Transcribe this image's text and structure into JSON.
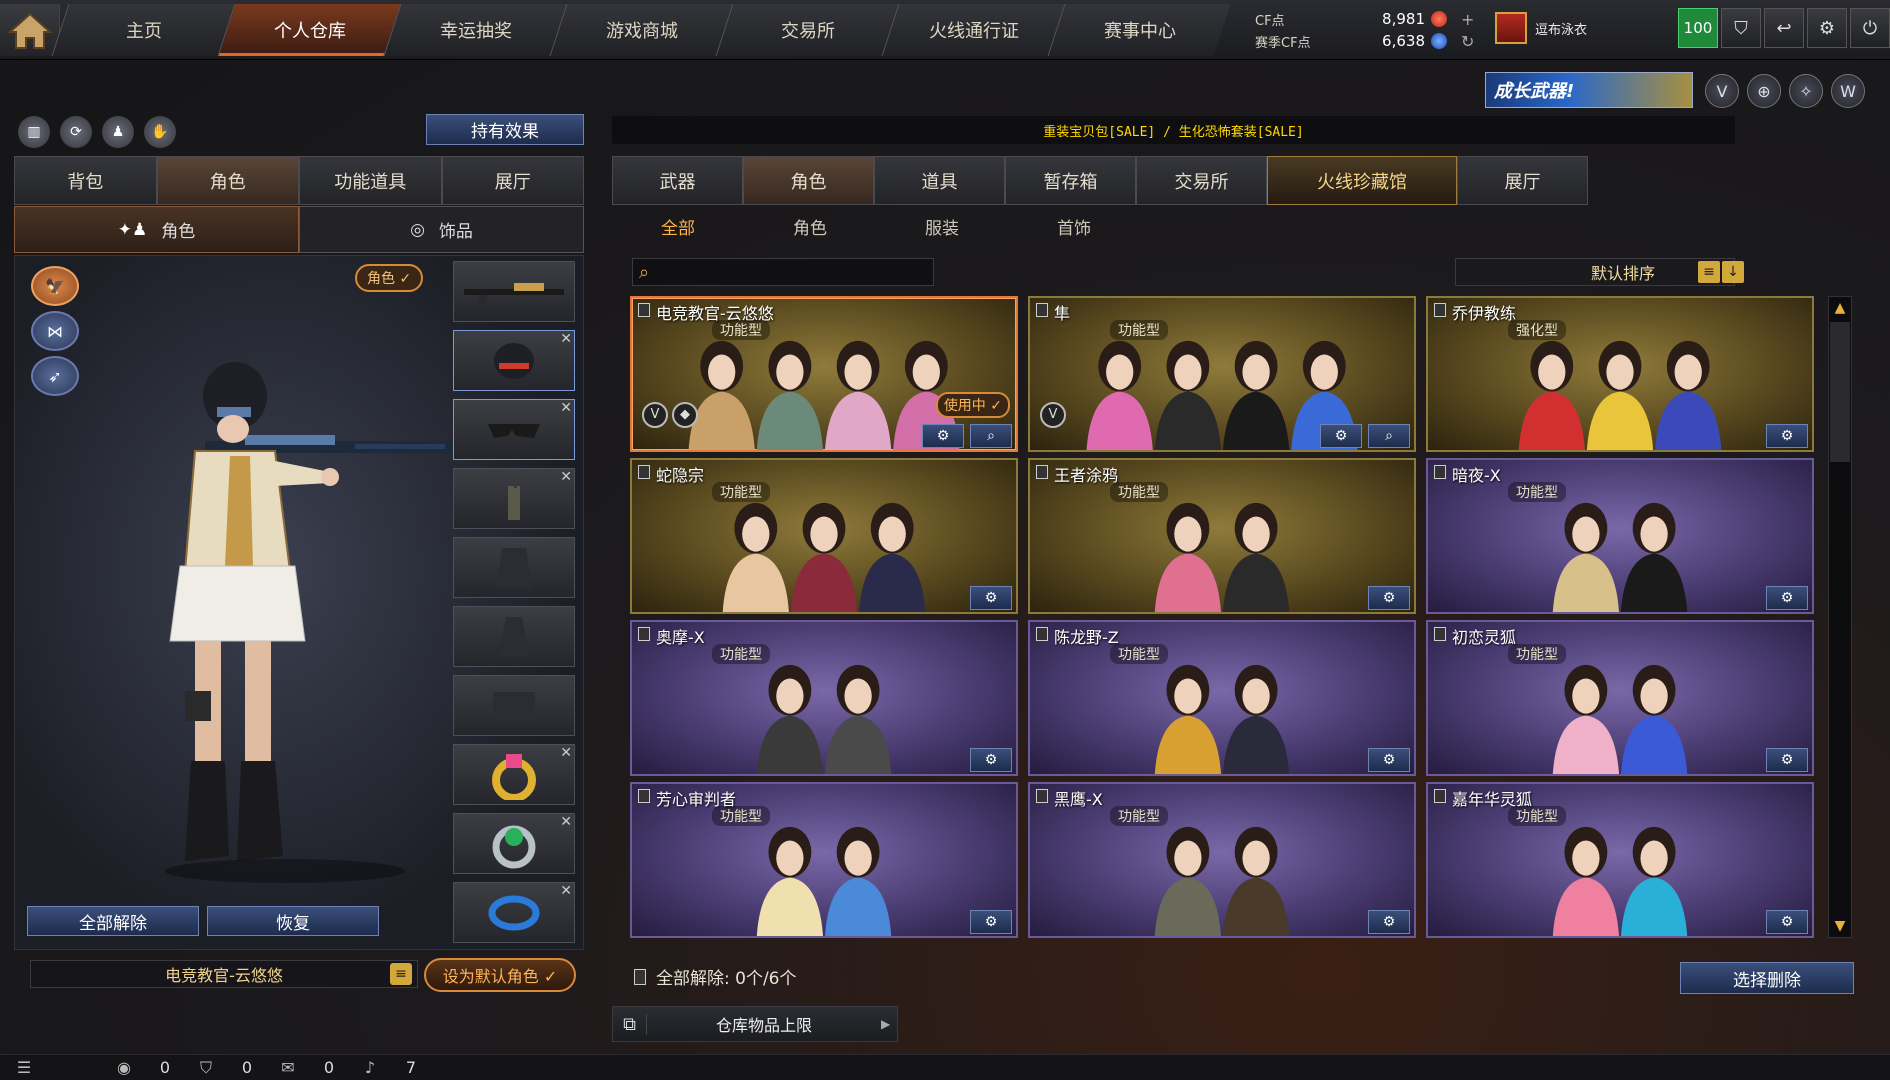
{
  "nav": {
    "home_icon": "home-icon",
    "tabs": [
      "主页",
      "个人仓库",
      "幸运抽奖",
      "游戏商城",
      "交易所",
      "火线通行证",
      "赛事中心"
    ],
    "active_tab": "个人仓库"
  },
  "currency": {
    "cf_label": "CF点",
    "cf_value": "8,981",
    "season_label": "赛季CF点",
    "season_value": "6,638"
  },
  "clan": {
    "name": "逗布泳衣"
  },
  "level": "100",
  "left": {
    "effects_button": "持有效果",
    "tabs": [
      "背包",
      "角色",
      "功能道具",
      "展厅"
    ],
    "active_tab": "角色",
    "subtabs": [
      "角色",
      "饰品"
    ],
    "active_subtab": "角色",
    "role_pill": "角色 ✓",
    "unequip_all": "全部解除",
    "restore": "恢复",
    "character_name": "电竞教官-云悠悠",
    "set_default": "设为默认角色 ✓"
  },
  "promo": {
    "banner_text": "成长武器!"
  },
  "marquee": "重装宝贝包[SALE] / 生化恐怖套装[SALE]",
  "right": {
    "tabs": [
      "武器",
      "角色",
      "道具",
      "暂存箱",
      "交易所",
      "火线珍藏馆",
      "展厅"
    ],
    "active_tab": "角色",
    "sub_tabs": [
      "全部",
      "角色",
      "服装",
      "首饰"
    ],
    "active_sub_tab": "全部",
    "search_placeholder": "",
    "sort_label": "默认排序",
    "in_use_label": "使用中 ✓",
    "cards": [
      {
        "name": "电竞教官-云悠悠",
        "type": "功能型",
        "style": "gold",
        "selected": true,
        "in_use": true,
        "search": true,
        "badges": [
          "V",
          "◆"
        ],
        "figures": 4,
        "colors": [
          "#c9a06a",
          "#6c8a7a",
          "#e1a7c6",
          "#d36fa8"
        ]
      },
      {
        "name": "隼",
        "type": "功能型",
        "style": "gold",
        "selected": false,
        "in_use": false,
        "search": true,
        "badges": [
          "V"
        ],
        "figures": 4,
        "colors": [
          "#e06ab0",
          "#2a2a2a",
          "#1a1a1a",
          "#3a6ad8"
        ]
      },
      {
        "name": "乔伊教练",
        "type": "强化型",
        "style": "gold",
        "selected": false,
        "in_use": false,
        "search": false,
        "badges": [],
        "figures": 3,
        "colors": [
          "#d23030",
          "#e8c53a",
          "#3a4ab8"
        ]
      },
      {
        "name": "蛇隐宗",
        "type": "功能型",
        "style": "gold",
        "selected": false,
        "in_use": false,
        "search": false,
        "badges": [],
        "figures": 3,
        "colors": [
          "#e8c6a0",
          "#8a2a3a",
          "#2a2a4a"
        ]
      },
      {
        "name": "王者涂鸦",
        "type": "功能型",
        "style": "gold",
        "selected": false,
        "in_use": false,
        "search": false,
        "badges": [],
        "figures": 2,
        "colors": [
          "#e07090",
          "#2a2a2a"
        ]
      },
      {
        "name": "暗夜-X",
        "type": "功能型",
        "style": "purple",
        "selected": false,
        "in_use": false,
        "search": false,
        "badges": [],
        "figures": 2,
        "colors": [
          "#d8c08a",
          "#1a1a1a"
        ]
      },
      {
        "name": "奥摩-X",
        "type": "功能型",
        "style": "purple",
        "selected": false,
        "in_use": false,
        "search": false,
        "badges": [],
        "figures": 2,
        "colors": [
          "#3a3a3a",
          "#4a4a4a"
        ]
      },
      {
        "name": "陈龙野-Z",
        "type": "功能型",
        "style": "purple",
        "selected": false,
        "in_use": false,
        "search": false,
        "badges": [],
        "figures": 2,
        "colors": [
          "#d8a030",
          "#2a2a3a"
        ]
      },
      {
        "name": "初恋灵狐",
        "type": "功能型",
        "style": "purple",
        "selected": false,
        "in_use": false,
        "search": false,
        "badges": [],
        "figures": 2,
        "colors": [
          "#f0b0c8",
          "#3a5ad8"
        ]
      },
      {
        "name": "芳心审判者",
        "type": "功能型",
        "style": "purple",
        "selected": false,
        "in_use": false,
        "search": false,
        "badges": [],
        "figures": 2,
        "colors": [
          "#f0e0b0",
          "#4a8ad8"
        ]
      },
      {
        "name": "黑鹰-X",
        "type": "功能型",
        "style": "purple",
        "selected": false,
        "in_use": false,
        "search": false,
        "badges": [],
        "figures": 2,
        "colors": [
          "#6a6a5a",
          "#4a3a2a"
        ]
      },
      {
        "name": "嘉年华灵狐",
        "type": "功能型",
        "style": "purple",
        "selected": false,
        "in_use": false,
        "search": false,
        "badges": [],
        "figures": 2,
        "colors": [
          "#f080a0",
          "#2ab0d8"
        ]
      }
    ],
    "unequip_count_label": "全部解除: 0个/6个",
    "select_delete": "选择删除",
    "storage_limit": "仓库物品上限"
  },
  "status": {
    "items": [
      {
        "icon": "bunny-icon",
        "glyph": "◉",
        "value": "0"
      },
      {
        "icon": "shield-icon",
        "glyph": "⛉",
        "value": "0"
      },
      {
        "icon": "chat-icon",
        "glyph": "✉",
        "value": "0"
      },
      {
        "icon": "speaker-icon",
        "glyph": "♪",
        "value": "7"
      }
    ]
  }
}
